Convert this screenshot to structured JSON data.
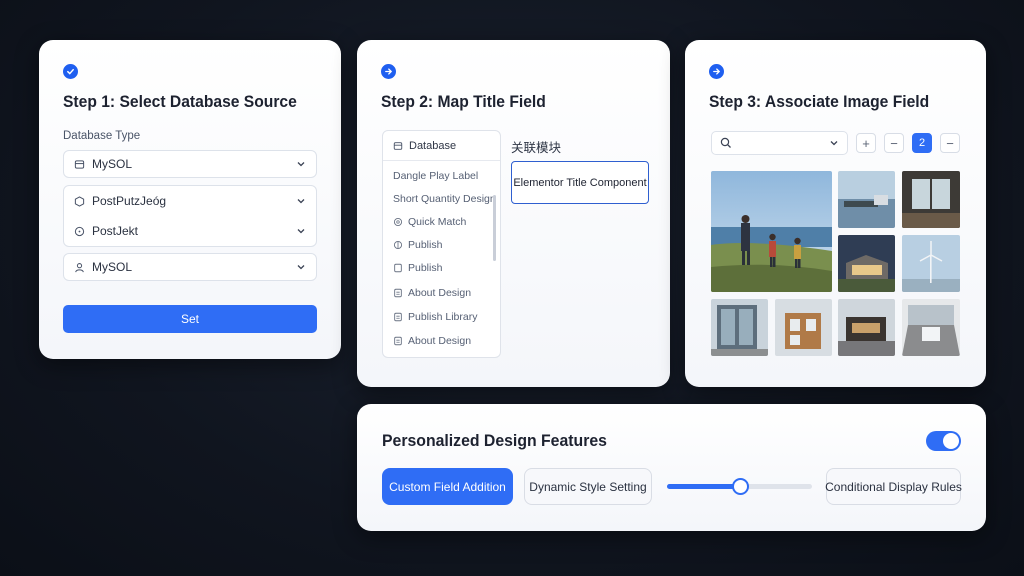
{
  "step1": {
    "title": "Step 1:  Select Database Source",
    "field_label": "Database Type",
    "select_1": "MySOL",
    "select_2": "PostPutzJeóg",
    "select_3": "PostJekt",
    "select_4": "MySOL",
    "set_button": "Set"
  },
  "step2": {
    "title": "Step 2:  Map Title Field",
    "list_header": "Database",
    "items": [
      "Dangle Play Label",
      "Short Quantity Design",
      "Quick Match",
      "Publish",
      "Publish",
      "About Design",
      "Publish Library",
      "About Design"
    ],
    "zh_label": "关联模块",
    "target": "Elementor Title Component"
  },
  "step3": {
    "title": "Step 3:  Associate Image Field",
    "active_tool": "2",
    "plus": "+",
    "minus": "−"
  },
  "features": {
    "title": "Personalized Design Features",
    "toggle_on": true,
    "custom_field": "Custom Field Addition",
    "dynamic_style": "Dynamic Style Setting",
    "slider_value": 0.5,
    "conditional": "Conditional Display Rules"
  },
  "colors": {
    "accent": "#2f6df5",
    "background": "#10151f"
  }
}
